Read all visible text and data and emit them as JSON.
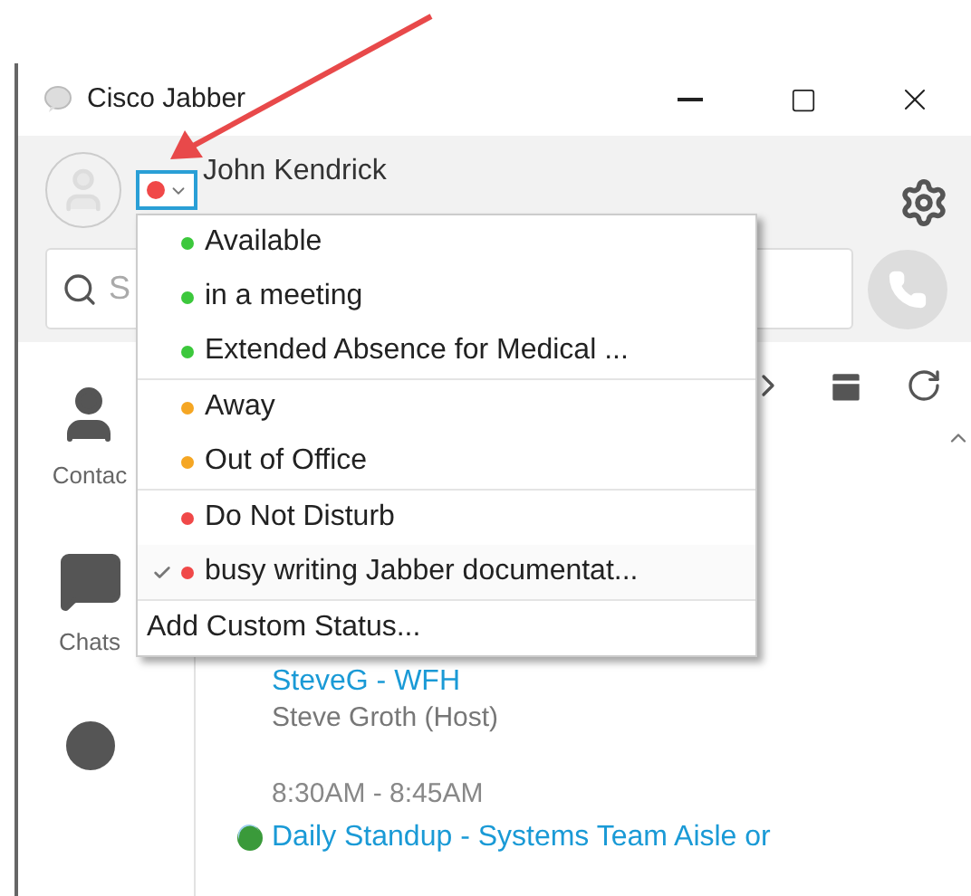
{
  "window": {
    "title": "Cisco Jabber"
  },
  "profile": {
    "name": "John Kendrick"
  },
  "search": {
    "placeholder": "S"
  },
  "nav": [
    {
      "kind": "contacts",
      "label": "Contac"
    },
    {
      "kind": "chats",
      "label": "Chats"
    },
    {
      "kind": "recents"
    }
  ],
  "meetings": [
    {
      "title": "SteveG - WFH",
      "host": "Steve Groth (Host)"
    },
    {
      "time": "8:30AM - 8:45AM",
      "title": "Daily Standup - Systems Team Aisle or",
      "webex": true
    }
  ],
  "status_menu": {
    "groups": [
      [
        {
          "label": "Available",
          "color": "#3cc83c",
          "selected": false
        },
        {
          "label": "in a meeting",
          "color": "#3cc83c",
          "selected": false
        },
        {
          "label": "Extended Absence for Medical ...",
          "color": "#3cc83c",
          "selected": false
        }
      ],
      [
        {
          "label": "Away",
          "color": "#f5a623",
          "selected": false
        },
        {
          "label": "Out of Office",
          "color": "#f5a623",
          "selected": false
        }
      ],
      [
        {
          "label": "Do Not Disturb",
          "color": "#f04848",
          "selected": false
        },
        {
          "label": "busy writing Jabber documentat...",
          "color": "#f04848",
          "selected": true
        }
      ]
    ],
    "add_custom": "Add Custom Status..."
  }
}
